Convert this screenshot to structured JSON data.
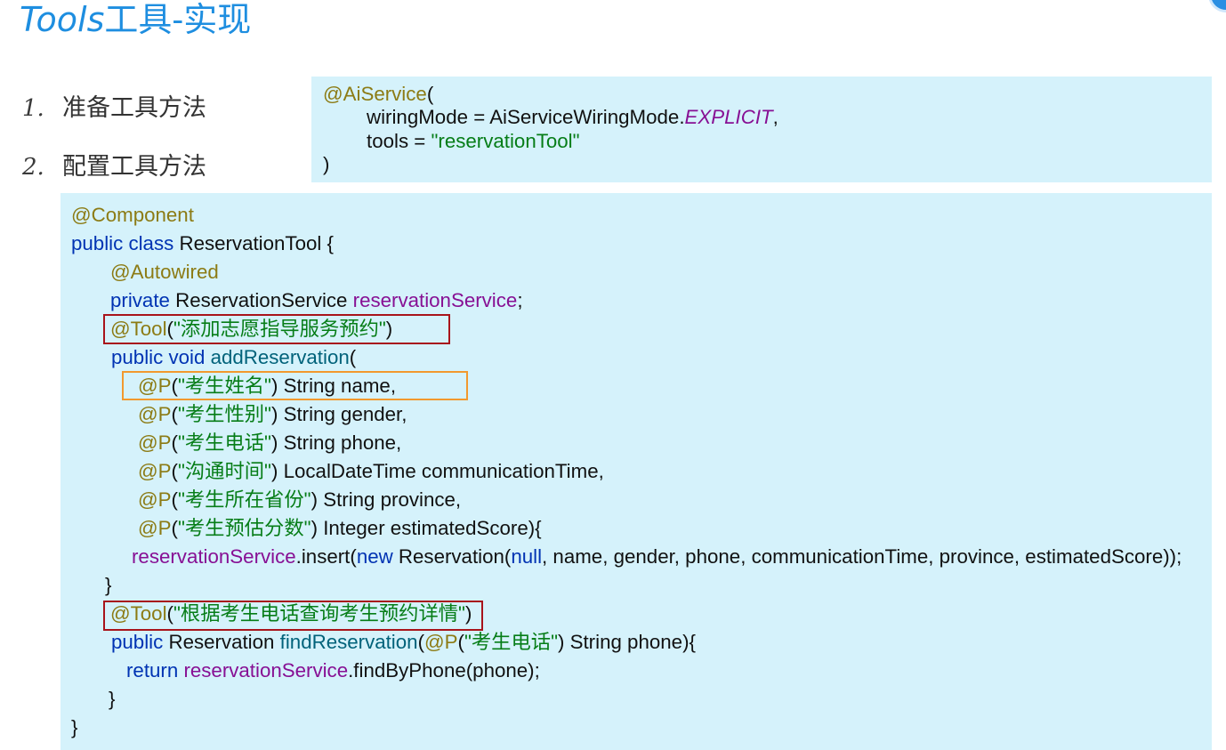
{
  "slide": {
    "title": {
      "latin": "Tools",
      "chinese": "工具-实现"
    },
    "steps": [
      {
        "number": "1.",
        "label": "准备工具方法"
      },
      {
        "number": "2.",
        "label": "配置工具方法"
      }
    ],
    "colors": {
      "title": "#1e8ee0",
      "code_background": "#d5f2fb",
      "highlight_red": "#a8141b",
      "highlight_orange": "#f2992e"
    }
  },
  "ai_service_snippet": {
    "lines": [
      {
        "tokens": [
          {
            "text": "@AiService",
            "color": "#8c7b14"
          },
          {
            "text": "("
          }
        ]
      },
      {
        "tokens": [
          {
            "text": "wiringMode = AiServiceWiringMode."
          },
          {
            "text": "EXPLICIT",
            "color": "#871094",
            "italic": true
          },
          {
            "text": ","
          }
        ]
      },
      {
        "tokens": [
          {
            "text": "tools = "
          },
          {
            "text": "\"reservationTool\"",
            "color": "#067d17"
          }
        ]
      },
      {
        "tokens": [
          {
            "text": ")"
          }
        ]
      }
    ]
  },
  "reservation_tool_code": {
    "lines": [
      {
        "tokens": [
          {
            "text": "@Component",
            "color": "#8c7b14"
          }
        ]
      },
      {
        "tokens": [
          {
            "text": "public class",
            "color": "#0033b3"
          },
          {
            "text": " ReservationTool {"
          }
        ]
      },
      {
        "tokens": [
          {
            "text": "@Autowired",
            "color": "#8c7b14"
          }
        ]
      },
      {
        "tokens": [
          {
            "text": "private",
            "color": "#0033b3"
          },
          {
            "text": " ReservationService "
          },
          {
            "text": "reservationService",
            "color": "#871094"
          },
          {
            "text": ";"
          }
        ]
      },
      {
        "tokens": [
          {
            "text": "@Tool",
            "color": "#8c7b14"
          },
          {
            "text": "("
          },
          {
            "text": "\"添加志愿指导服务预约\"",
            "color": "#067d17"
          },
          {
            "text": ")"
          }
        ]
      },
      {
        "tokens": [
          {
            "text": "public void",
            "color": "#0033b3"
          },
          {
            "text": " "
          },
          {
            "text": "addReservation",
            "color": "#00627a"
          },
          {
            "text": "("
          }
        ]
      },
      {
        "tokens": [
          {
            "text": "@P",
            "color": "#8c7b14"
          },
          {
            "text": "("
          },
          {
            "text": "\"考生姓名\"",
            "color": "#067d17"
          },
          {
            "text": ") String name,"
          }
        ]
      },
      {
        "tokens": [
          {
            "text": "@P",
            "color": "#8c7b14"
          },
          {
            "text": "("
          },
          {
            "text": "\"考生性别\"",
            "color": "#067d17"
          },
          {
            "text": ") String gender,"
          }
        ]
      },
      {
        "tokens": [
          {
            "text": "@P",
            "color": "#8c7b14"
          },
          {
            "text": "("
          },
          {
            "text": "\"考生电话\"",
            "color": "#067d17"
          },
          {
            "text": ") String phone,"
          }
        ]
      },
      {
        "tokens": [
          {
            "text": "@P",
            "color": "#8c7b14"
          },
          {
            "text": "("
          },
          {
            "text": "\"沟通时间\"",
            "color": "#067d17"
          },
          {
            "text": ") LocalDateTime communicationTime,"
          }
        ]
      },
      {
        "tokens": [
          {
            "text": "@P",
            "color": "#8c7b14"
          },
          {
            "text": "("
          },
          {
            "text": "\"考生所在省份\"",
            "color": "#067d17"
          },
          {
            "text": ") String province,"
          }
        ]
      },
      {
        "tokens": [
          {
            "text": "@P",
            "color": "#8c7b14"
          },
          {
            "text": "("
          },
          {
            "text": "\"考生预估分数\"",
            "color": "#067d17"
          },
          {
            "text": ") Integer estimatedScore){"
          }
        ]
      },
      {
        "tokens": [
          {
            "text": "reservationService",
            "color": "#871094"
          },
          {
            "text": ".insert("
          },
          {
            "text": "new",
            "color": "#0033b3"
          },
          {
            "text": " Reservation("
          },
          {
            "text": "null",
            "color": "#0033b3"
          },
          {
            "text": ", name, gender, phone, communicationTime, province, estimatedScore));"
          }
        ]
      },
      {
        "tokens": [
          {
            "text": "}"
          }
        ]
      },
      {
        "tokens": [
          {
            "text": "@Tool",
            "color": "#8c7b14"
          },
          {
            "text": "("
          },
          {
            "text": "\"根据考生电话查询考生预约详情\"",
            "color": "#067d17"
          },
          {
            "text": ")"
          }
        ]
      },
      {
        "tokens": [
          {
            "text": "public",
            "color": "#0033b3"
          },
          {
            "text": " Reservation "
          },
          {
            "text": "findReservation",
            "color": "#00627a"
          },
          {
            "text": "("
          },
          {
            "text": "@P",
            "color": "#8c7b14"
          },
          {
            "text": "("
          },
          {
            "text": "\"考生电话\"",
            "color": "#067d17"
          },
          {
            "text": ") String phone){"
          }
        ]
      },
      {
        "tokens": [
          {
            "text": "return",
            "color": "#0033b3"
          },
          {
            "text": " "
          },
          {
            "text": "reservationService",
            "color": "#871094"
          },
          {
            "text": ".findByPhone(phone);"
          }
        ]
      },
      {
        "tokens": [
          {
            "text": "}"
          }
        ]
      },
      {
        "tokens": [
          {
            "text": "}"
          }
        ]
      }
    ]
  }
}
